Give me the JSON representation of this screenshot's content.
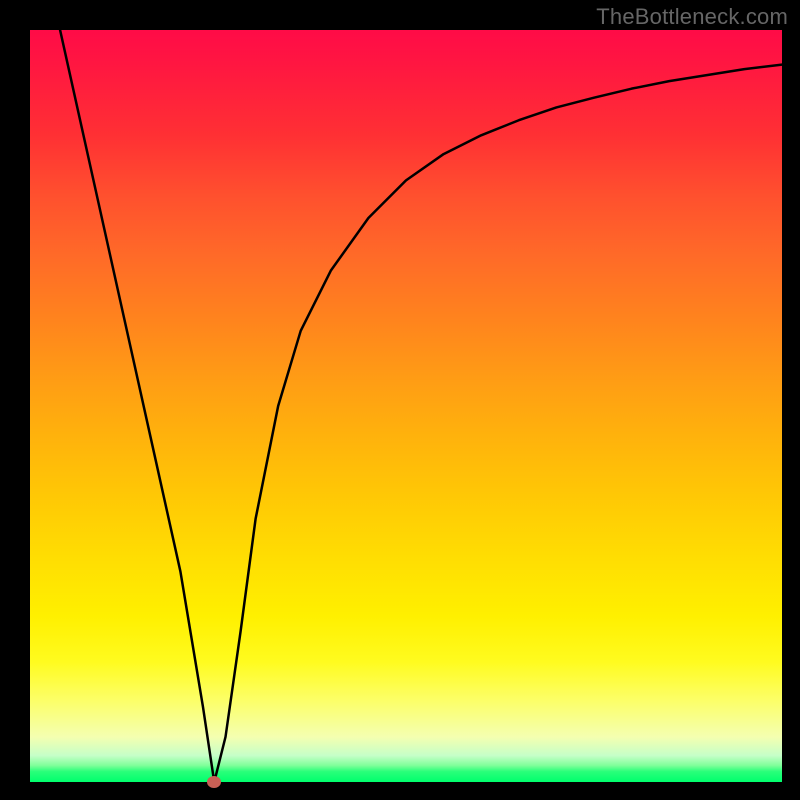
{
  "watermark": "TheBottleneck.com",
  "chart_data": {
    "type": "line",
    "title": "",
    "xlabel": "",
    "ylabel": "",
    "xlim": [
      0,
      100
    ],
    "ylim": [
      0,
      100
    ],
    "x": [
      4,
      8,
      12,
      16,
      20,
      23,
      24.5,
      26,
      28,
      30,
      33,
      36,
      40,
      45,
      50,
      55,
      60,
      65,
      70,
      75,
      80,
      85,
      90,
      95,
      100
    ],
    "values": [
      100,
      82,
      64,
      46,
      28,
      10,
      0,
      6,
      20,
      35,
      50,
      60,
      68,
      75,
      80,
      83.5,
      86,
      88,
      89.7,
      91,
      92.2,
      93.2,
      94,
      94.8,
      95.4
    ],
    "marker": {
      "x": 24.5,
      "y": 0
    },
    "background_gradient": {
      "stops": [
        {
          "pos": 0,
          "color": "#ff0b47"
        },
        {
          "pos": 50,
          "color": "#ffb20c"
        },
        {
          "pos": 80,
          "color": "#fffb1f"
        },
        {
          "pos": 100,
          "color": "#00ff6d"
        }
      ]
    }
  }
}
